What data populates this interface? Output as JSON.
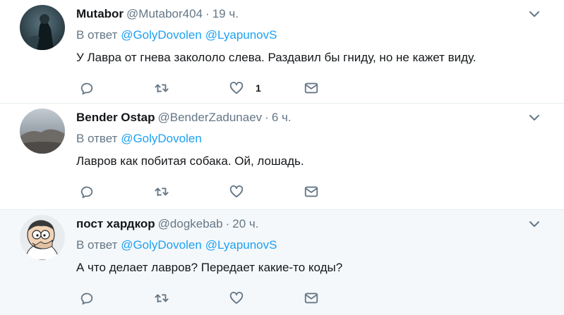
{
  "reply_prefix": "В ответ",
  "tweets": [
    {
      "name": "Mutabor",
      "handle": "@Mutabor404",
      "separator": "·",
      "time": "19 ч.",
      "mentions": [
        "@GolyDovolen",
        "@LyapunovS"
      ],
      "text": "У Лавра от гнева закололо слева. Раздавил бы гниду, но не кажет виду.",
      "like_count": "1"
    },
    {
      "name": "Bender Ostap",
      "handle": "@BenderZadunaev",
      "separator": "·",
      "time": "6 ч.",
      "mentions": [
        "@GolyDovolen"
      ],
      "text": "Лавров как побитая собака. Ой, лошадь.",
      "like_count": ""
    },
    {
      "name": "пост хардкор",
      "handle": "@dogkebab",
      "separator": "·",
      "time": "20 ч.",
      "mentions": [
        "@GolyDovolen",
        "@LyapunovS"
      ],
      "text": "А что делает лавров? Передает какие-то коды?",
      "like_count": ""
    }
  ],
  "icons": {
    "reply": "reply-icon",
    "retweet": "retweet-icon",
    "like": "heart-icon",
    "dm": "envelope-icon",
    "menu": "chevron-down-icon"
  },
  "colors": {
    "text": "#14171a",
    "muted": "#657786",
    "link": "#1da1f2",
    "highlight_bg": "#f5f8fa",
    "divider": "#e6ecf0"
  }
}
